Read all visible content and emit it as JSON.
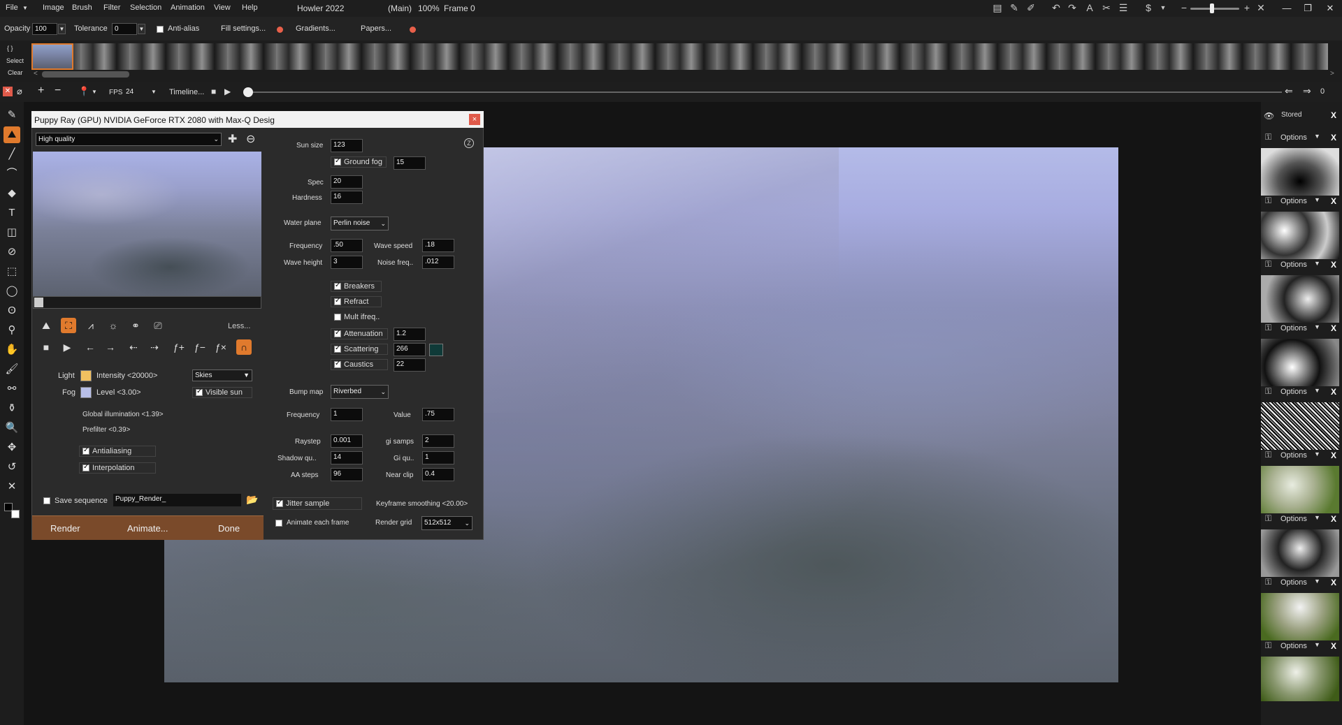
{
  "menubar": {
    "items": [
      "File",
      "Image",
      "Brush",
      "Filter",
      "Selection",
      "Animation",
      "View",
      "Help"
    ],
    "app_title": "Howler 2022",
    "doc_status": "(Main)",
    "zoom": "100%",
    "frame": "Frame 0"
  },
  "optionbar": {
    "opacity_label": "Opacity",
    "opacity_value": "100",
    "tolerance_label": "Tolerance",
    "tolerance_value": "0",
    "antialias_label": "Anti-alias",
    "fill_settings": "Fill settings...",
    "gradients": "Gradients...",
    "papers": "Papers..."
  },
  "filmstrip": {
    "select_label": "Select",
    "clear_label": "Clear"
  },
  "timeline": {
    "fps_label": "FPS",
    "fps_value": "24",
    "timeline_label": "Timeline...",
    "frame_counter": "0"
  },
  "dialog": {
    "title": "Puppy Ray (GPU)  NVIDIA GeForce RTX 2080 with Max-Q Desig",
    "quality": "High quality",
    "less_label": "Less...",
    "light_label": "Light",
    "intensity": "Intensity <20000>",
    "skies": "Skies",
    "fog_label": "Fog",
    "fog_level": "Level <3.00>",
    "visible_sun": "Visible sun",
    "global_illumination": "Global illumination <1.39>",
    "prefilter": "Prefilter <0.39>",
    "antialiasing": "Antialiasing",
    "interpolation": "Interpolation",
    "save_sequence": "Save sequence",
    "sequence_name": "Puppy_Render_",
    "render": "Render",
    "animate": "Animate...",
    "done": "Done",
    "sun_size_label": "Sun size",
    "sun_size": "123",
    "ground_fog_label": "Ground fog",
    "ground_fog": "15",
    "spec_label": "Spec",
    "spec": "20",
    "hardness_label": "Hardness",
    "hardness": "16",
    "water_plane_label": "Water plane",
    "water_plane": "Perlin noise",
    "frequency_label": "Frequency",
    "frequency": ".50",
    "wave_speed_label": "Wave speed",
    "wave_speed": ".18",
    "wave_height_label": "Wave height",
    "wave_height": "3",
    "noise_freq_label": "Noise freq..",
    "noise_freq": ".012",
    "breakers": "Breakers",
    "refract": "Refract",
    "mult_ifreq": "Mult ifreq..",
    "attenuation": "Attenuation",
    "attenuation_value": "1.2",
    "scattering": "Scattering",
    "scattering_value": "266",
    "scattering_color": "#0f3a38",
    "caustics": "Caustics",
    "caustics_value": "22",
    "bump_map_label": "Bump map",
    "bump_map": "Riverbed",
    "bump_frequency_label": "Frequency",
    "bump_frequency": "1",
    "value_label": "Value",
    "value": ".75",
    "raystep_label": "Raystep",
    "raystep": "0.001",
    "gi_samps_label": "gi samps",
    "gi_samps": "2",
    "shadow_qu_label": "Shadow qu..",
    "shadow_qu": "14",
    "gi_qu_label": "Gi qu..",
    "gi_qu": "1",
    "aa_steps_label": "AA steps",
    "aa_steps": "96",
    "near_clip_label": "Near clip",
    "near_clip": "0.4",
    "jitter_sample": "Jitter sample",
    "keyframe_smoothing": "Keyframe smoothing <20.00>",
    "animate_each_frame": "Animate each frame",
    "render_grid_label": "Render grid",
    "render_grid": "512x512",
    "light_color": "#f2c060",
    "fog_color": "#b8bfe8"
  },
  "rightpanel": {
    "stored_label": "Stored",
    "options_label": "Options",
    "option_rows": [
      "Options",
      "Options",
      "Options",
      "Options",
      "Options",
      "Options",
      "Options",
      "Options",
      "Options"
    ]
  }
}
